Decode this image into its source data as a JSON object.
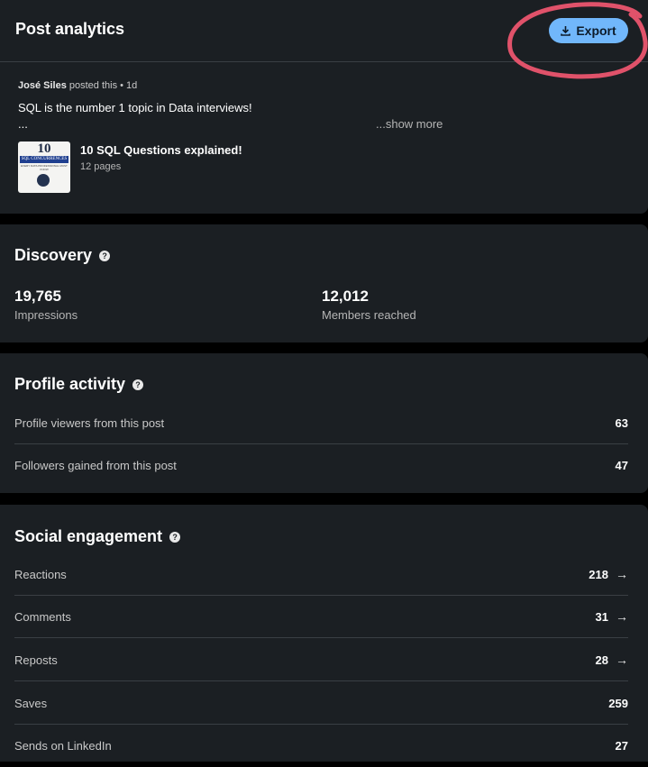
{
  "header": {
    "title": "Post analytics",
    "export_label": "Export"
  },
  "post": {
    "author": "José Siles",
    "meta": " posted this • 1d",
    "text": "SQL is the number 1 topic in Data interviews!",
    "ellipsis": "...",
    "show_more": "...show more",
    "document": {
      "thumb_number": "10",
      "thumb_band": "SQL CONCURRENCES",
      "thumb_sub": "EVERY DATA PROFESSIONAL MUST KNOW",
      "title": "10 SQL Questions explained!",
      "pages": "12 pages"
    }
  },
  "discovery": {
    "title": "Discovery",
    "impressions_value": "19,765",
    "impressions_label": "Impressions",
    "members_value": "12,012",
    "members_label": "Members reached"
  },
  "profile_activity": {
    "title": "Profile activity",
    "rows": [
      {
        "label": "Profile viewers from this post",
        "value": "63"
      },
      {
        "label": "Followers gained from this post",
        "value": "47"
      }
    ]
  },
  "social_engagement": {
    "title": "Social engagement",
    "rows": [
      {
        "label": "Reactions",
        "value": "218"
      },
      {
        "label": "Comments",
        "value": "31"
      },
      {
        "label": "Reposts",
        "value": "28"
      },
      {
        "label": "Saves",
        "value": "259"
      },
      {
        "label": "Sends on LinkedIn",
        "value": "27"
      }
    ]
  },
  "icons": {
    "help": "help-icon",
    "arrow": "arrow-right-icon",
    "download": "download-icon"
  },
  "colors": {
    "background": "#1b1f23",
    "accent": "#71b7fb",
    "annotation": "#e0526a"
  }
}
